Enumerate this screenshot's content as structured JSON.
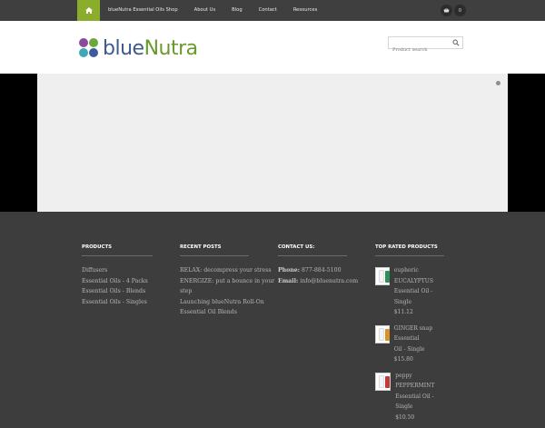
{
  "nav": {
    "items": [
      "blueNutra Essential Oils Shop",
      "About Us",
      "Blog",
      "Contact",
      "Resources"
    ],
    "cart_count": "0",
    "home_color": "#8aad2b"
  },
  "header": {
    "logo_blue": "blue",
    "logo_nutra": "Nutra",
    "search_placeholder": "Product search"
  },
  "footer": {
    "products": {
      "title": "PRODUCTS",
      "items": [
        "Diffusers",
        "Essential Oils - 4 Packs",
        "Essential Oils - Blends",
        "Essential Oils - Singles"
      ]
    },
    "recent_posts": {
      "title": "RECENT POSTS",
      "items": [
        "RELAX: decompress your stress",
        "ENERGIZE: put a bounce in your",
        "step",
        "Launching blueNutra Roll-On",
        "Essential Oil Blends"
      ]
    },
    "contact": {
      "title": "CONTACT US:",
      "phone_label": "Phone:",
      "phone": "877-884-5100",
      "email_label": "Email:",
      "email": "info@bluenutra.com"
    },
    "top_rated": {
      "title": "TOP RATED PRODUCTS",
      "items": [
        {
          "line1": "euphoric EUCALYPTUS",
          "line2": "Essential Oil - Single",
          "price": "$11.12",
          "accent": "#2f8f5a"
        },
        {
          "line1": "GINGER snap Essential",
          "line2": "Oil - Single",
          "price": "$15.80",
          "accent": "#d9922b"
        },
        {
          "line1": "peppy PEPPERMINT",
          "line2": "Essential Oil - Single",
          "price": "$10.50",
          "accent": "#c23a3a"
        }
      ]
    }
  }
}
